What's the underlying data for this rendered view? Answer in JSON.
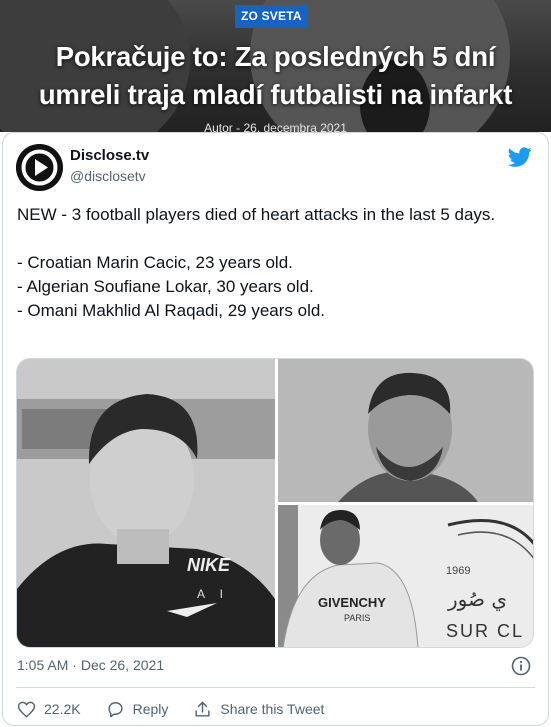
{
  "article": {
    "category": "ZO SVETA",
    "headline_line1": "Pokračuje to: Za posledných 5 dní",
    "headline_line2": "umreli traja mladí futbalisti na infarkt",
    "author_label": "Autor",
    "date": "26. decembra 2021"
  },
  "tweet": {
    "display_name": "Disclose.tv",
    "handle": "@disclosetv",
    "text": "NEW - 3 football players died of heart attacks in the last 5 days.\n\n- Croatian Marin Cacic, 23 years old.\n- Algerian Soufiane Lokar, 30 years old.\n- Omani Makhlid Al Raqadi, 29 years old.",
    "photo_texts": {
      "shirt_brand": "NIKE",
      "shirt_sub": "A I",
      "tee_brand": "GIVENCHY",
      "tee_sub": "PARIS",
      "sign_year": "1969",
      "sign_arabic": "ي صُور",
      "sign_latin": "SUR CL"
    },
    "time": "1:05 AM",
    "date": "Dec 26, 2021",
    "likes": "22.2K",
    "reply_label": "Reply",
    "share_label": "Share this Tweet"
  },
  "colors": {
    "badge": "#1565c0",
    "twitter_blue": "#1d9bf0",
    "text_primary": "#0f1419",
    "text_secondary": "#536471",
    "border": "#cfd9de"
  },
  "icons": {
    "avatar": "play-circle-logo",
    "brand": "twitter-bird-icon",
    "info": "info-icon",
    "like": "heart-icon",
    "reply": "reply-bubble-icon",
    "share": "share-upload-icon"
  }
}
